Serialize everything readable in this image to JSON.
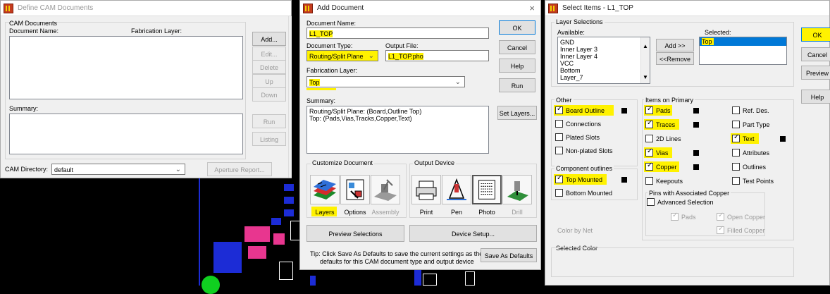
{
  "colors": {
    "highlight": "#fff200",
    "selected": "#0078d7",
    "pcb_pink": "#e8368f",
    "pcb_blue": "#1c2cd6",
    "pcb_green": "#10d020"
  },
  "define_cam": {
    "title": "Define CAM Documents",
    "group_label": "CAM Documents",
    "col_document_name": "Document Name:",
    "col_fabrication_layer": "Fabrication Layer:",
    "summary_label": "Summary:",
    "cam_directory_label": "CAM Directory:",
    "cam_directory_value": "default",
    "buttons": {
      "add": "Add...",
      "edit": "Edit...",
      "delete": "Delete",
      "up": "Up",
      "down": "Down",
      "run": "Run",
      "listing": "Listing",
      "aperture_report": "Aperture Report..."
    }
  },
  "add_document": {
    "title": "Add Document",
    "close": "×",
    "document_name_label": "Document Name:",
    "document_name_value": "L1_TOP",
    "document_type_label": "Document Type:",
    "document_type_value": "Routing/Split Plane",
    "output_file_label": "Output File:",
    "output_file_value": "L1_TOP.pho",
    "fabrication_layer_label": "Fabrication Layer:",
    "fabrication_layer_value": "Top",
    "summary_label": "Summary:",
    "summary_line1": "Routing/Split Plane: (Board,Outline Top)",
    "summary_line2": "Top: (Pads,Vias,Tracks,Copper,Text)",
    "customize_label": "Customize Document",
    "output_device_label": "Output Device",
    "custom_buttons": [
      {
        "label": "Layers",
        "icon": "layers-icon"
      },
      {
        "label": "Options",
        "icon": "options-icon"
      },
      {
        "label": "Assembly",
        "icon": "assembly-icon"
      }
    ],
    "device_buttons": [
      {
        "label": "Print",
        "icon": "printer-icon"
      },
      {
        "label": "Pen",
        "icon": "pen-plotter-icon"
      },
      {
        "label": "Photo",
        "icon": "photo-plotter-icon"
      },
      {
        "label": "Drill",
        "icon": "drill-icon"
      }
    ],
    "preview_selections": "Preview Selections",
    "device_setup": "Device Setup...",
    "tip_line1": "Tip: Click Save As Defaults to save the current settings as the",
    "tip_line2": "defaults for this CAM document type and output device",
    "buttons": {
      "ok": "OK",
      "cancel": "Cancel",
      "help": "Help",
      "run": "Run",
      "set_layers": "Set Layers...",
      "save_defaults": "Save As Defaults"
    }
  },
  "select_items": {
    "title": "Select Items - L1_TOP",
    "layer_selections": "Layer Selections",
    "available_label": "Available:",
    "selected_label": "Selected:",
    "available_items": [
      "GND",
      "Inner Layer 3",
      "Inner Layer 4",
      "VCC",
      "Bottom",
      "Layer_7"
    ],
    "selected_items": [
      "Top"
    ],
    "add_btn": "Add >>",
    "remove_btn": "<<Remove",
    "other_label": "Other",
    "other_items": [
      {
        "label": "Board Outline",
        "checked": true,
        "highlight": true,
        "color": true
      },
      {
        "label": "Connections",
        "checked": false,
        "highlight": false,
        "color": false
      },
      {
        "label": "Plated Slots",
        "checked": false,
        "highlight": false,
        "color": false
      },
      {
        "label": "Non-plated Slots",
        "checked": false,
        "highlight": false,
        "color": false
      }
    ],
    "component_outlines_label": "Component outlines",
    "component_items": [
      {
        "label": "Top Mounted",
        "checked": true,
        "highlight": true,
        "color": true
      },
      {
        "label": "Bottom Mounted",
        "checked": false,
        "highlight": false,
        "color": false
      }
    ],
    "items_on_primary_label": "Items on Primary",
    "primary_col1": [
      {
        "label": "Pads",
        "checked": true,
        "highlight": true,
        "color": true
      },
      {
        "label": "Traces",
        "checked": true,
        "highlight": true,
        "color": true
      },
      {
        "label": "2D Lines",
        "checked": false,
        "highlight": false,
        "color": false
      },
      {
        "label": "Vias",
        "checked": true,
        "highlight": true,
        "color": true
      },
      {
        "label": "Copper",
        "checked": true,
        "highlight": true,
        "color": true
      },
      {
        "label": "Keepouts",
        "checked": false,
        "highlight": false,
        "color": false
      }
    ],
    "primary_col2": [
      {
        "label": "Ref. Des.",
        "checked": false,
        "highlight": false,
        "color": false
      },
      {
        "label": "Part Type",
        "checked": false,
        "highlight": false,
        "color": false
      },
      {
        "label": "Text",
        "checked": true,
        "highlight": true,
        "color": true
      },
      {
        "label": "Attributes",
        "checked": false,
        "highlight": false,
        "color": false
      },
      {
        "label": "Outlines",
        "checked": false,
        "highlight": false,
        "color": false
      },
      {
        "label": "Test Points",
        "checked": false,
        "highlight": false,
        "color": false
      }
    ],
    "pins_label": "Pins with Associated Copper",
    "advanced_selection": "Advanced Selection",
    "pads_sub": "Pads",
    "open_copper": "Open Copper",
    "filled_copper": "Filled Copper",
    "color_by_net": "Color by Net",
    "selected_color_label": "Selected Color",
    "buttons": {
      "ok": "OK",
      "cancel": "Cancel",
      "preview": "Preview",
      "help": "Help"
    }
  }
}
